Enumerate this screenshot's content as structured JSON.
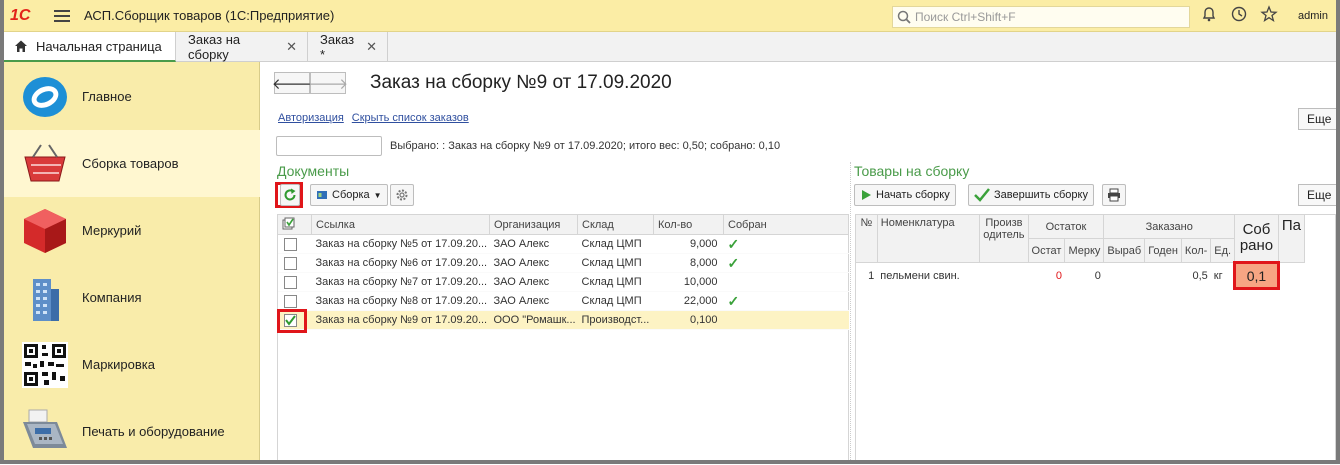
{
  "app": {
    "logo": "1С",
    "title": "АСП.Сборщик товаров  (1С:Предприятие)",
    "search_placeholder": "Поиск Ctrl+Shift+F",
    "user": "admin"
  },
  "tabs": [
    {
      "label": "Начальная страница"
    },
    {
      "label": "Заказ на сборку"
    },
    {
      "label": "Заказ *"
    }
  ],
  "sidebar": {
    "items": [
      {
        "label": "Главное",
        "icon": "main-logo-icon"
      },
      {
        "label": "Сборка товаров",
        "icon": "basket-icon"
      },
      {
        "label": "Меркурий",
        "icon": "cube-icon"
      },
      {
        "label": "Компания",
        "icon": "building-icon"
      },
      {
        "label": "Маркировка",
        "icon": "qr-code-icon"
      },
      {
        "label": "Печать и оборудование",
        "icon": "card-terminal-icon"
      }
    ]
  },
  "form": {
    "title": "Заказ на сборку №9 от 17.09.2020",
    "link_auth": "Авторизация",
    "link_hide": "Скрыть список заказов",
    "more_label": "Еще",
    "selected_text": "Выбрано: : Заказ на сборку №9 от 17.09.2020; итого вес: 0,50; собрано: 0,10"
  },
  "documents": {
    "title": "Документы",
    "assembly_button": "Сборка",
    "columns": [
      "Ссылка",
      "Организация",
      "Склад",
      "Кол-во",
      "Собран"
    ],
    "rows": [
      {
        "link": "Заказ на сборку №5 от 17.09.20...",
        "org": "ЗАО Алекс",
        "warehouse": "Склад ЦМП",
        "qty": "9,000",
        "collected": "✓",
        "checked": false
      },
      {
        "link": "Заказ на сборку №6 от 17.09.20...",
        "org": "ЗАО Алекс",
        "warehouse": "Склад ЦМП",
        "qty": "8,000",
        "collected": "✓",
        "checked": false
      },
      {
        "link": "Заказ на сборку №7 от 17.09.20...",
        "org": "ЗАО Алекс",
        "warehouse": "Склад ЦМП",
        "qty": "10,000",
        "collected": "",
        "checked": false
      },
      {
        "link": "Заказ на сборку №8 от 17.09.20...",
        "org": "ЗАО Алекс",
        "warehouse": "Склад ЦМП",
        "qty": "22,000",
        "collected": "✓",
        "checked": false
      },
      {
        "link": "Заказ на сборку №9 от 17.09.20...",
        "org": "ООО \"Ромашк...",
        "warehouse": "Производст...",
        "qty": "0,100",
        "collected": "",
        "checked": true
      }
    ]
  },
  "goods": {
    "title": "Товары на сборку",
    "start_button": "Начать сборку",
    "finish_button": "Завершить сборку",
    "more_label": "Еще",
    "headers": {
      "n": "№",
      "nomenclature": "Номенклатура",
      "producer": "Произв одитель",
      "balance": "Остаток",
      "ordered": "Заказано",
      "balance_sub": [
        "Остат",
        "Мерку"
      ],
      "ordered_sub": [
        "Выраб",
        "Годен",
        "Кол-",
        "Ед."
      ],
      "collected": "Соб рано",
      "pa": "Па"
    },
    "rows": [
      {
        "n": "1",
        "name": "пельмени свин.",
        "ostat": "0",
        "merku": "0",
        "qty": "0,5",
        "unit": "кг",
        "collected": "0,1"
      }
    ],
    "colors": {
      "negative": "#e0161a",
      "collected_bg": "#f7a583"
    }
  }
}
